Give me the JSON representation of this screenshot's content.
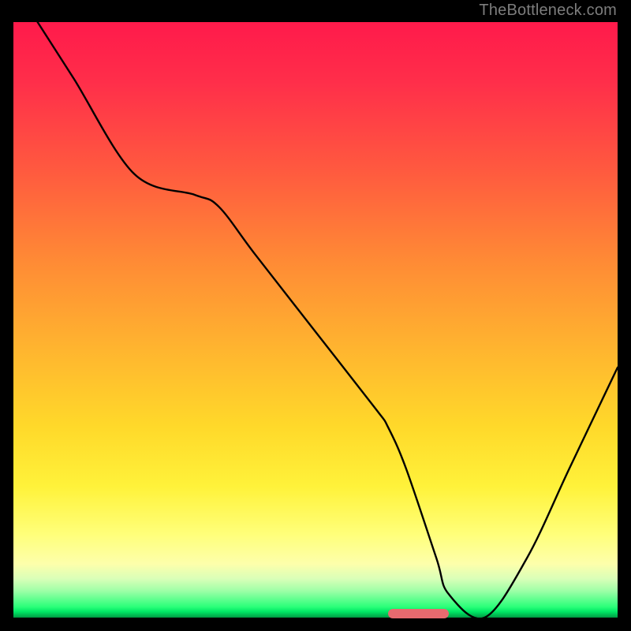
{
  "attribution": "TheBottleneck.com",
  "chart_data": {
    "type": "line",
    "title": "",
    "xlabel": "",
    "ylabel": "",
    "xlim": [
      0,
      100
    ],
    "ylim": [
      0,
      100
    ],
    "series": [
      {
        "name": "curve",
        "x": [
          4,
          10,
          20,
          30,
          34,
          40,
          50,
          60,
          62,
          65,
          70,
          72,
          78,
          85,
          92,
          100
        ],
        "values": [
          100,
          90.5,
          74.5,
          71,
          69,
          61,
          48,
          35,
          32,
          25,
          10,
          4,
          0,
          10,
          25,
          42
        ]
      }
    ],
    "marker": {
      "x_start": 62,
      "x_end": 72,
      "y": 0.7
    },
    "colors": {
      "curve": "#000000",
      "marker": "#e86a6f",
      "gradient_top": "#ff1a4b",
      "gradient_bottom": "#009b44"
    }
  }
}
